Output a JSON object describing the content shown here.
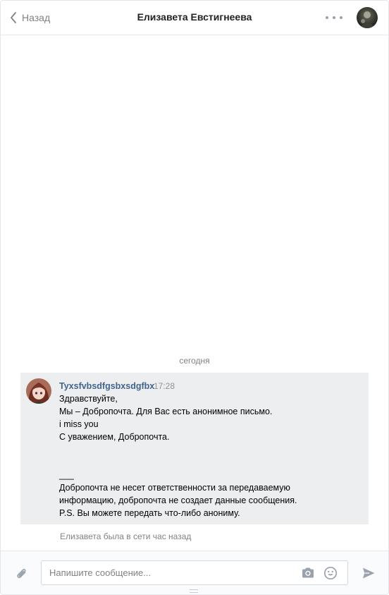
{
  "header": {
    "back_label": "Назад",
    "title": "Елизавета Евстигнеева",
    "back_icon": "chevron-left-icon",
    "more_icon": "more-horizontal-icon"
  },
  "chat": {
    "date_separator": "сегодня",
    "message": {
      "author": "Tyxsfvbsdfgsbxsdgfbx",
      "time": "17:28",
      "lines": [
        "Здравствуйте,",
        "Мы – Добропочта. Для Вас есть анонимное письмо.",
        "i miss you",
        "С уважением, Добропочта.",
        "",
        "",
        "___",
        "Добропочта не несет ответственности за передаваемую",
        "информацию, добропочта не создает данные сообщения.",
        "P.S. Вы можете передать что-либо анониму."
      ]
    },
    "status": "Елизавета была в сети час назад"
  },
  "composer": {
    "placeholder": "Напишите сообщение...",
    "icons": [
      "paperclip-icon",
      "camera-icon",
      "smile-icon",
      "send-icon"
    ]
  },
  "colors": {
    "accent_link": "#42648b",
    "message_bg": "#edeef0",
    "muted_text": "#828282",
    "icon_gray": "#99a2ad"
  }
}
